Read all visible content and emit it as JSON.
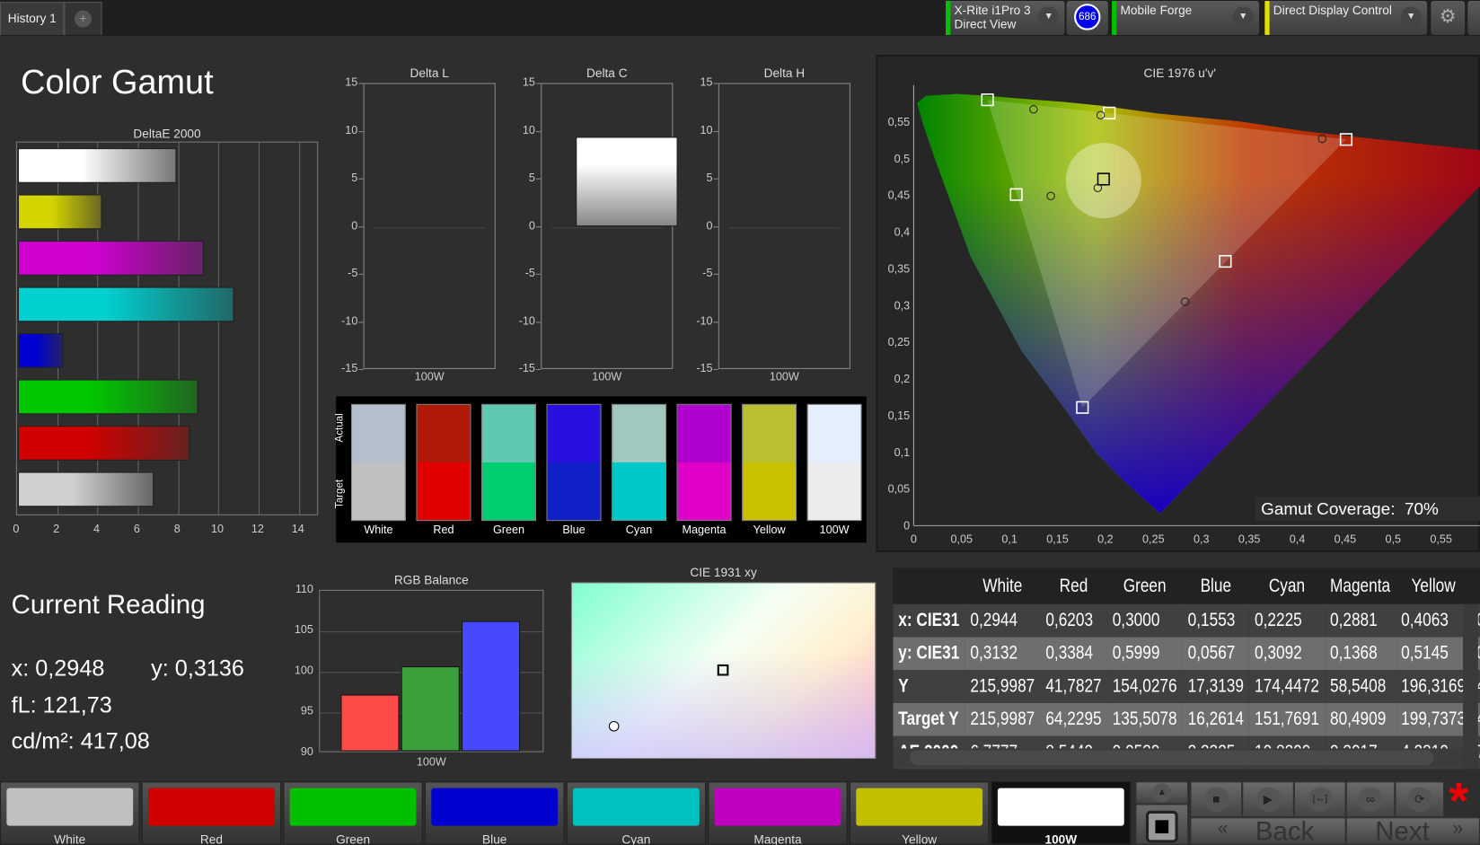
{
  "topbar": {
    "tab": "History 1",
    "add_tab": "+",
    "meter": {
      "line1": "X-Rite i1Pro 3",
      "line2": "Direct View",
      "color": "#00c000"
    },
    "badge": "686",
    "source": {
      "label": "Mobile Forge",
      "color": "#00c000"
    },
    "display": {
      "label": "Direct Display Control",
      "color": "#e0e000"
    }
  },
  "page_title": "Color Gamut",
  "chart_data": [
    {
      "type": "bar",
      "title": "DeltaE 2000",
      "orientation": "horizontal",
      "xlim": [
        0,
        15
      ],
      "ticks": [
        "0",
        "2",
        "4",
        "6",
        "8",
        "10",
        "12",
        "14"
      ],
      "categories": [
        "White",
        "Yellow",
        "Magenta",
        "Cyan",
        "Blue",
        "Green",
        "Red",
        "Gray"
      ],
      "values": [
        7.9,
        4.2,
        9.3,
        10.8,
        2.3,
        9.0,
        8.6,
        6.8
      ],
      "colors": [
        "#ffffff",
        "#d4d400",
        "#d000d0",
        "#00d0d0",
        "#0000d0",
        "#00c800",
        "#d00000",
        "#d0d0d0"
      ]
    },
    {
      "type": "bar",
      "title": "Delta L",
      "categories": [
        "100W"
      ],
      "values": [
        0
      ],
      "ylim": [
        -15,
        15
      ],
      "ticks": [
        "15",
        "10",
        "5",
        "0",
        "-5",
        "-10",
        "-15"
      ]
    },
    {
      "type": "bar",
      "title": "Delta C",
      "categories": [
        "100W"
      ],
      "values": [
        9.5
      ],
      "ylim": [
        -15,
        15
      ],
      "ticks": [
        "15",
        "10",
        "5",
        "0",
        "-5",
        "-10",
        "-15"
      ]
    },
    {
      "type": "bar",
      "title": "Delta H",
      "categories": [
        "100W"
      ],
      "values": [
        0
      ],
      "ylim": [
        -15,
        15
      ],
      "ticks": [
        "15",
        "10",
        "5",
        "0",
        "-5",
        "-10",
        "-15"
      ]
    },
    {
      "type": "scatter",
      "title": "CIE 1976 u'v'",
      "xlim": [
        0,
        0.6
      ],
      "ylim": [
        0,
        0.58
      ],
      "xticks": [
        "0",
        "0,05",
        "0,1",
        "0,15",
        "0,2",
        "0,25",
        "0,3",
        "0,35",
        "0,4",
        "0,45",
        "0,5",
        "0,55"
      ],
      "yticks": [
        "0",
        "0,05",
        "0,1",
        "0,15",
        "0,2",
        "0,25",
        "0,3",
        "0,35",
        "0,4",
        "0,45",
        "0,5",
        "0,55"
      ],
      "targets": [
        [
          0.451,
          0.526
        ],
        [
          0.077,
          0.58
        ],
        [
          0.176,
          0.161
        ],
        [
          0.198,
          0.472
        ],
        [
          0.107,
          0.451
        ],
        [
          0.325,
          0.36
        ],
        [
          0.204,
          0.562
        ]
      ],
      "measured": [
        [
          0.426,
          0.527
        ],
        [
          0.125,
          0.567
        ],
        [
          0.192,
          0.46
        ],
        [
          0.143,
          0.449
        ],
        [
          0.283,
          0.305
        ],
        [
          0.195,
          0.559
        ]
      ],
      "coverage_label": "Gamut Coverage:",
      "coverage": "70%"
    },
    {
      "type": "bar",
      "title": "RGB Balance",
      "categories": [
        "R",
        "G",
        "B"
      ],
      "xlabel": "100W",
      "values": [
        97,
        100.5,
        106
      ],
      "ylim": [
        90,
        110
      ],
      "ticks": [
        "110",
        "105",
        "100",
        "95",
        "90"
      ],
      "colors": [
        "#ff4a4a",
        "#3ca03c",
        "#4848ff"
      ]
    },
    {
      "type": "scatter",
      "title": "CIE 1931 xy",
      "target": [
        0.3127,
        0.329
      ],
      "measured": [
        0.2948,
        0.3136
      ]
    }
  ],
  "swatches": {
    "actual_label": "Actual",
    "target_label": "Target",
    "items": [
      {
        "label": "White",
        "actual": "#b4bfcc",
        "target": "#c0c0c0"
      },
      {
        "label": "Red",
        "actual": "#b01808",
        "target": "#e00000"
      },
      {
        "label": "Green",
        "actual": "#60c8b0",
        "target": "#00cc70"
      },
      {
        "label": "Blue",
        "actual": "#2a10e0",
        "target": "#1020c8"
      },
      {
        "label": "Cyan",
        "actual": "#a0c8c0",
        "target": "#00c8c8"
      },
      {
        "label": "Magenta",
        "actual": "#b000d0",
        "target": "#e000c8"
      },
      {
        "label": "Yellow",
        "actual": "#b8c030",
        "target": "#c8c000"
      },
      {
        "label": "100W",
        "actual": "#e4eefc",
        "target": "#ececec"
      }
    ]
  },
  "current": {
    "title": "Current Reading",
    "x": "x: 0,2948",
    "y": "y: 0,3136",
    "fl": "fL: 121,73",
    "cd": "cd/m²: 417,08"
  },
  "table": {
    "headers": [
      "",
      "White",
      "Red",
      "Green",
      "Blue",
      "Cyan",
      "Magenta",
      "Yellow",
      "1"
    ],
    "rows": [
      [
        "x: CIE31",
        "0,2944",
        "0,6203",
        "0,3000",
        "0,1553",
        "0,2225",
        "0,2881",
        "0,4063",
        "0,2"
      ],
      [
        "y: CIE31",
        "0,3132",
        "0,3384",
        "0,5999",
        "0,0567",
        "0,3092",
        "0,1368",
        "0,5145",
        "0,3"
      ],
      [
        "Y",
        "215,9987",
        "41,7827",
        "154,0276",
        "17,3139",
        "174,4472",
        "58,5408",
        "196,3169",
        "41"
      ],
      [
        "Target Y",
        "215,9987",
        "64,2295",
        "135,5078",
        "16,2614",
        "151,7691",
        "80,4909",
        "199,7373",
        "41"
      ],
      [
        "ΔE 2000",
        "6,7777",
        "8,5449",
        "9,0539",
        "2,3325",
        "10,8200",
        "9,3017",
        "4,2310",
        "7,0"
      ]
    ]
  },
  "patches": [
    {
      "label": "White",
      "color": "#c0c0c0"
    },
    {
      "label": "Red",
      "color": "#d00000"
    },
    {
      "label": "Green",
      "color": "#00c000"
    },
    {
      "label": "Blue",
      "color": "#0000d0"
    },
    {
      "label": "Cyan",
      "color": "#00c0c0"
    },
    {
      "label": "Magenta",
      "color": "#c000c0"
    },
    {
      "label": "Yellow",
      "color": "#c0c000"
    },
    {
      "label": "100W",
      "color": "#ffffff"
    }
  ],
  "controls": {
    "back": "Back",
    "next": "Next",
    "stop": "■",
    "play": "▶",
    "fit": "[↔]",
    "loop": "∞",
    "refresh": "⟳",
    "up": "▲",
    "asterisk": "*"
  }
}
